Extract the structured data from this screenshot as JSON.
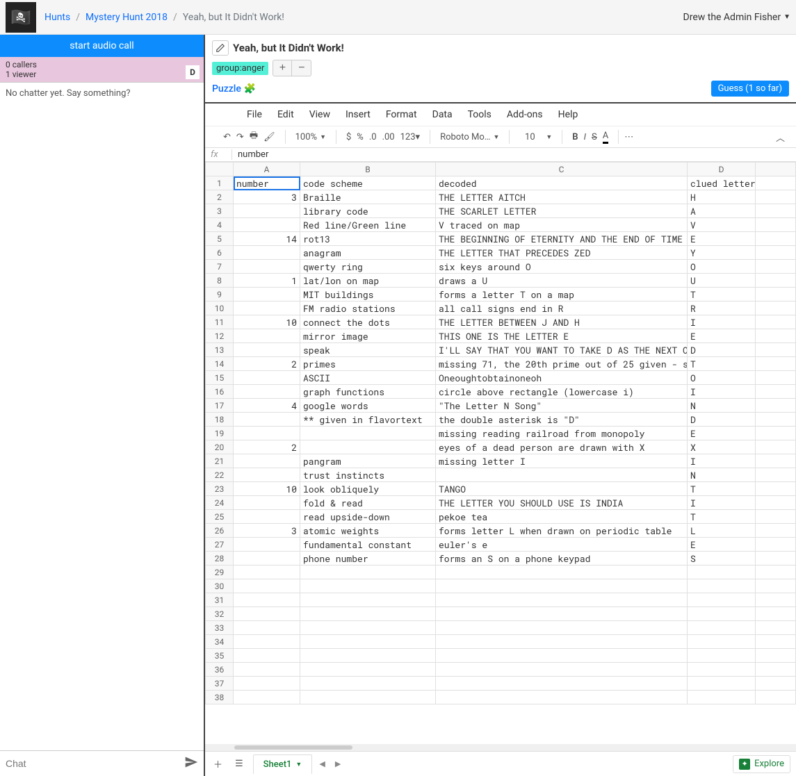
{
  "breadcrumb": {
    "root": "Hunts",
    "hunt": "Mystery Hunt 2018",
    "puzzle": "Yeah, but It Didn't Work!"
  },
  "user": "Drew the Admin Fisher",
  "left": {
    "audio_btn": "start audio call",
    "callers": "0 callers",
    "viewers": "1 viewer",
    "badge": "D",
    "chat_empty": "No chatter yet. Say something?",
    "chat_placeholder": "Chat"
  },
  "header": {
    "title": "Yeah, but It Didn't Work!",
    "tag": "group:anger",
    "puzzle_link": "Puzzle",
    "guess_btn": "Guess (1 so far)"
  },
  "sheets": {
    "menu": [
      "File",
      "Edit",
      "View",
      "Insert",
      "Format",
      "Data",
      "Tools",
      "Add-ons",
      "Help"
    ],
    "toolbar": {
      "zoom": "100%",
      "font": "Roboto Mo…",
      "size": "10"
    },
    "fx_value": "number",
    "columns": [
      "A",
      "B",
      "C",
      "D"
    ],
    "col_widths": [
      "col-A",
      "col-B",
      "col-C",
      "col-D"
    ],
    "rows": [
      {
        "n": "1",
        "a": "number",
        "b": "code scheme",
        "c": "decoded",
        "d": "clued letter",
        "a_num": false,
        "sel": true
      },
      {
        "n": "2",
        "a": "3",
        "b": "Braille",
        "c": "THE LETTER AITCH",
        "d": "H",
        "a_num": true
      },
      {
        "n": "3",
        "a": "",
        "b": "library code",
        "c": "THE SCARLET LETTER",
        "d": "A"
      },
      {
        "n": "4",
        "a": "",
        "b": "Red line/Green line",
        "c": "V traced on map",
        "d": "V"
      },
      {
        "n": "5",
        "a": "14",
        "b": "rot13",
        "c": "THE BEGINNING OF ETERNITY AND THE END OF TIME",
        "d": "E",
        "a_num": true
      },
      {
        "n": "6",
        "a": "",
        "b": "anagram",
        "c": "THE LETTER THAT PRECEDES ZED",
        "d": "Y"
      },
      {
        "n": "7",
        "a": "",
        "b": "qwerty ring",
        "c": "six keys around O",
        "d": "O"
      },
      {
        "n": "8",
        "a": "1",
        "b": "lat/lon on map",
        "c": "draws a U",
        "d": "U",
        "a_num": true
      },
      {
        "n": "9",
        "a": "",
        "b": "MIT buildings",
        "c": "forms a letter T on a map",
        "d": "T"
      },
      {
        "n": "10",
        "a": "",
        "b": "FM radio stations",
        "c": "all call signs end in R",
        "d": "R"
      },
      {
        "n": "11",
        "a": "10",
        "b": "connect the dots",
        "c": "THE LETTER BETWEEN J AND H",
        "d": "I",
        "a_num": true
      },
      {
        "n": "12",
        "a": "",
        "b": "mirror image",
        "c": "THIS ONE IS THE LETTER E",
        "d": "E"
      },
      {
        "n": "13",
        "a": "",
        "b": "speak",
        "c": "I'LL SAY THAT YOU WANT TO TAKE D AS THE NEXT O",
        "d": "D"
      },
      {
        "n": "14",
        "a": "2",
        "b": "primes",
        "c": "missing 71, the 20th prime out of 25 given - s",
        "d": "T",
        "a_num": true
      },
      {
        "n": "15",
        "a": "",
        "b": "ASCII",
        "c": "Oneoughtobtainoneoh",
        "d": "O"
      },
      {
        "n": "16",
        "a": "",
        "b": "graph functions",
        "c": "circle above rectangle (lowercase i)",
        "d": "I"
      },
      {
        "n": "17",
        "a": "4",
        "b": "google words",
        "c": "\"The Letter N Song\"",
        "d": "N",
        "a_num": true
      },
      {
        "n": "18",
        "a": "",
        "b": "** given in flavortext",
        "c": "the double asterisk is \"D\"",
        "d": "D"
      },
      {
        "n": "19",
        "a": "",
        "b": "",
        "c": "missing reading railroad from monopoly",
        "d": "E"
      },
      {
        "n": "20",
        "a": "2",
        "b": "",
        "c": "eyes of a dead person are drawn with X",
        "d": "X",
        "a_num": true
      },
      {
        "n": "21",
        "a": "",
        "b": "pangram",
        "c": "missing letter I",
        "d": "I"
      },
      {
        "n": "22",
        "a": "",
        "b": "trust instincts",
        "c": "",
        "d": "N"
      },
      {
        "n": "23",
        "a": "10",
        "b": "look obliquely",
        "c": "TANGO",
        "d": "T",
        "a_num": true
      },
      {
        "n": "24",
        "a": "",
        "b": "fold & read",
        "c": "THE LETTER YOU SHOULD USE IS INDIA",
        "d": "I"
      },
      {
        "n": "25",
        "a": "",
        "b": "read upside-down",
        "c": "pekoe tea",
        "d": "T"
      },
      {
        "n": "26",
        "a": "3",
        "b": "atomic weights",
        "c": "forms letter L when drawn on periodic table",
        "d": "L",
        "a_num": true
      },
      {
        "n": "27",
        "a": "",
        "b": "fundamental constant",
        "c": "euler's e",
        "d": "E"
      },
      {
        "n": "28",
        "a": "",
        "b": "phone number",
        "c": "forms an S on a phone keypad",
        "d": "S"
      },
      {
        "n": "29",
        "a": "",
        "b": "",
        "c": "",
        "d": ""
      },
      {
        "n": "30",
        "a": "",
        "b": "",
        "c": "",
        "d": ""
      },
      {
        "n": "31",
        "a": "",
        "b": "",
        "c": "",
        "d": ""
      },
      {
        "n": "32",
        "a": "",
        "b": "",
        "c": "",
        "d": ""
      },
      {
        "n": "33",
        "a": "",
        "b": "",
        "c": "",
        "d": ""
      },
      {
        "n": "34",
        "a": "",
        "b": "",
        "c": "",
        "d": ""
      },
      {
        "n": "35",
        "a": "",
        "b": "",
        "c": "",
        "d": ""
      },
      {
        "n": "36",
        "a": "",
        "b": "",
        "c": "",
        "d": ""
      },
      {
        "n": "37",
        "a": "",
        "b": "",
        "c": "",
        "d": ""
      },
      {
        "n": "38",
        "a": "",
        "b": "",
        "c": "",
        "d": ""
      }
    ],
    "tab": "Sheet1",
    "explore": "Explore"
  }
}
